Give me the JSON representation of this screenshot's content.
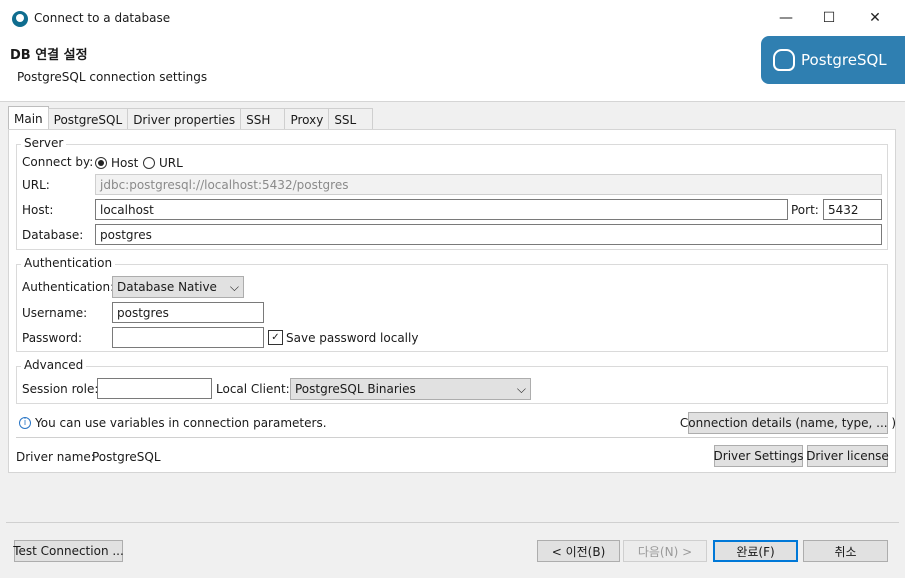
{
  "window": {
    "title": "Connect to a database",
    "minimize_glyph": "—",
    "maximize_glyph": "☐",
    "close_glyph": "✕"
  },
  "header": {
    "title": "DB 연결 설정",
    "subtitle": "PostgreSQL connection settings",
    "logo_text": "PostgreSQL"
  },
  "tabs": [
    {
      "label": "Main"
    },
    {
      "label": "PostgreSQL"
    },
    {
      "label": "Driver properties"
    },
    {
      "label": "SSH"
    },
    {
      "label": "Proxy"
    },
    {
      "label": "SSL"
    }
  ],
  "server": {
    "title": "Server",
    "connect_by_label": "Connect by:",
    "host_option": "Host",
    "url_option": "URL",
    "url_label": "URL:",
    "url_value": "jdbc:postgresql://localhost:5432/postgres",
    "host_label": "Host:",
    "host_value": "localhost",
    "port_label": "Port:",
    "port_value": "5432",
    "database_label": "Database:",
    "database_value": "postgres"
  },
  "auth": {
    "title": "Authentication",
    "auth_label": "Authentication:",
    "auth_value": "Database Native",
    "username_label": "Username:",
    "username_value": "postgres",
    "password_label": "Password:",
    "password_value": "",
    "save_password_label": "Save password locally"
  },
  "advanced": {
    "title": "Advanced",
    "session_role_label": "Session role:",
    "session_role_value": "",
    "local_client_label": "Local Client:",
    "local_client_value": "PostgreSQL Binaries"
  },
  "info": {
    "text": "You can use variables in connection parameters.",
    "conn_details_button": "Connection details (name, type, ... )"
  },
  "driver": {
    "label": "Driver name:",
    "value": "PostgreSQL",
    "settings_button": "Driver Settings",
    "license_button": "Driver license"
  },
  "footer": {
    "test_button": "Test Connection ...",
    "back_button": "< 이전(B)",
    "next_button": "다음(N) >",
    "finish_button": "완료(F)",
    "cancel_button": "취소"
  },
  "glyphs": {
    "chevron": "⌵",
    "check": "✓",
    "info": "i"
  }
}
